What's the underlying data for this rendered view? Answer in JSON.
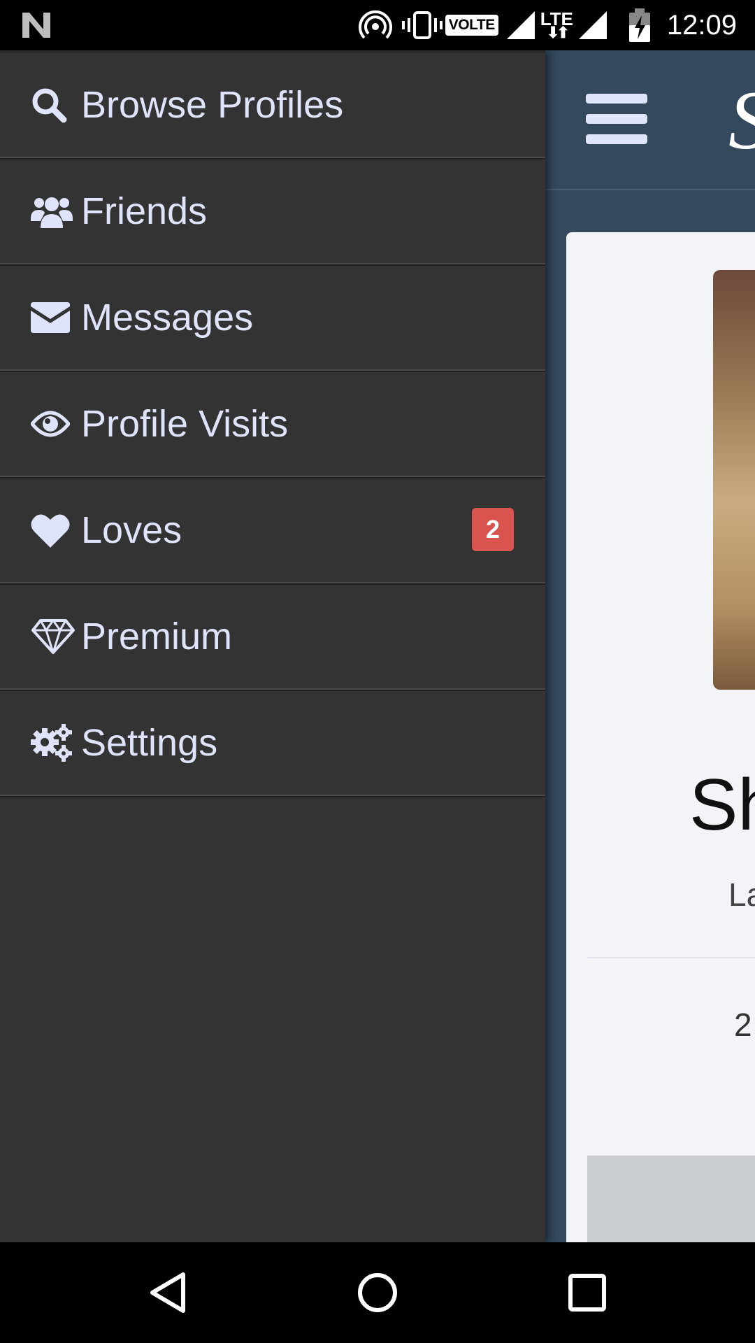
{
  "status_bar": {
    "network_label": "VOLTE",
    "lte_label": "LTE",
    "time": "12:09"
  },
  "drawer": {
    "items": [
      {
        "label": "Browse Profiles",
        "icon": "search-icon"
      },
      {
        "label": "Friends",
        "icon": "users-icon"
      },
      {
        "label": "Messages",
        "icon": "envelope-icon"
      },
      {
        "label": "Profile Visits",
        "icon": "eye-icon"
      },
      {
        "label": "Loves",
        "icon": "heart-icon",
        "badge": "2"
      },
      {
        "label": "Premium",
        "icon": "diamond-icon"
      },
      {
        "label": "Settings",
        "icon": "gears-icon"
      }
    ]
  },
  "background_app": {
    "brand_partial": "S",
    "profile_name_partial": "Sh",
    "profile_sub_partial": "La",
    "profile_stat_partial": "2"
  },
  "colors": {
    "drawer_bg": "#333333",
    "drawer_text": "#dfe4fb",
    "badge_bg": "#d9534f",
    "app_header_bg": "#34495e"
  }
}
